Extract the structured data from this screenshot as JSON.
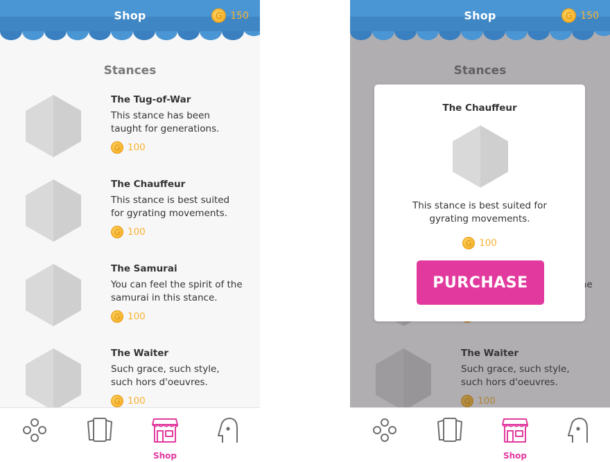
{
  "header": {
    "title": "Shop",
    "coins": "150",
    "coin_symbol": "G"
  },
  "section_title": "Stances",
  "items": [
    {
      "name": "The Tug-of-War",
      "description": "This stance has been taught for generations.",
      "price": "100"
    },
    {
      "name": "The Chauffeur",
      "description": "This stance is best suited for gyrating movements.",
      "price": "100"
    },
    {
      "name": "The Samurai",
      "description": "You can feel the spirit of the samurai in this stance.",
      "price": "100"
    },
    {
      "name": "The Waiter",
      "description": "Such grace, such style, such hors d'oeuvres.",
      "price": "100"
    }
  ],
  "nav": [
    {
      "icon": "gamepad-icon",
      "label": ""
    },
    {
      "icon": "cards-icon",
      "label": ""
    },
    {
      "icon": "shop-icon",
      "label": "Shop",
      "active": true
    },
    {
      "icon": "profile-icon",
      "label": ""
    }
  ],
  "modal": {
    "title": "The Chauffeur",
    "description": "This stance is best suited for gyrating movements.",
    "price": "100",
    "button_label": "PURCHASE"
  },
  "colors": {
    "header_blue": "#4a95d3",
    "accent_pink": "#e2399e",
    "coin_gold": "#f9b233"
  }
}
